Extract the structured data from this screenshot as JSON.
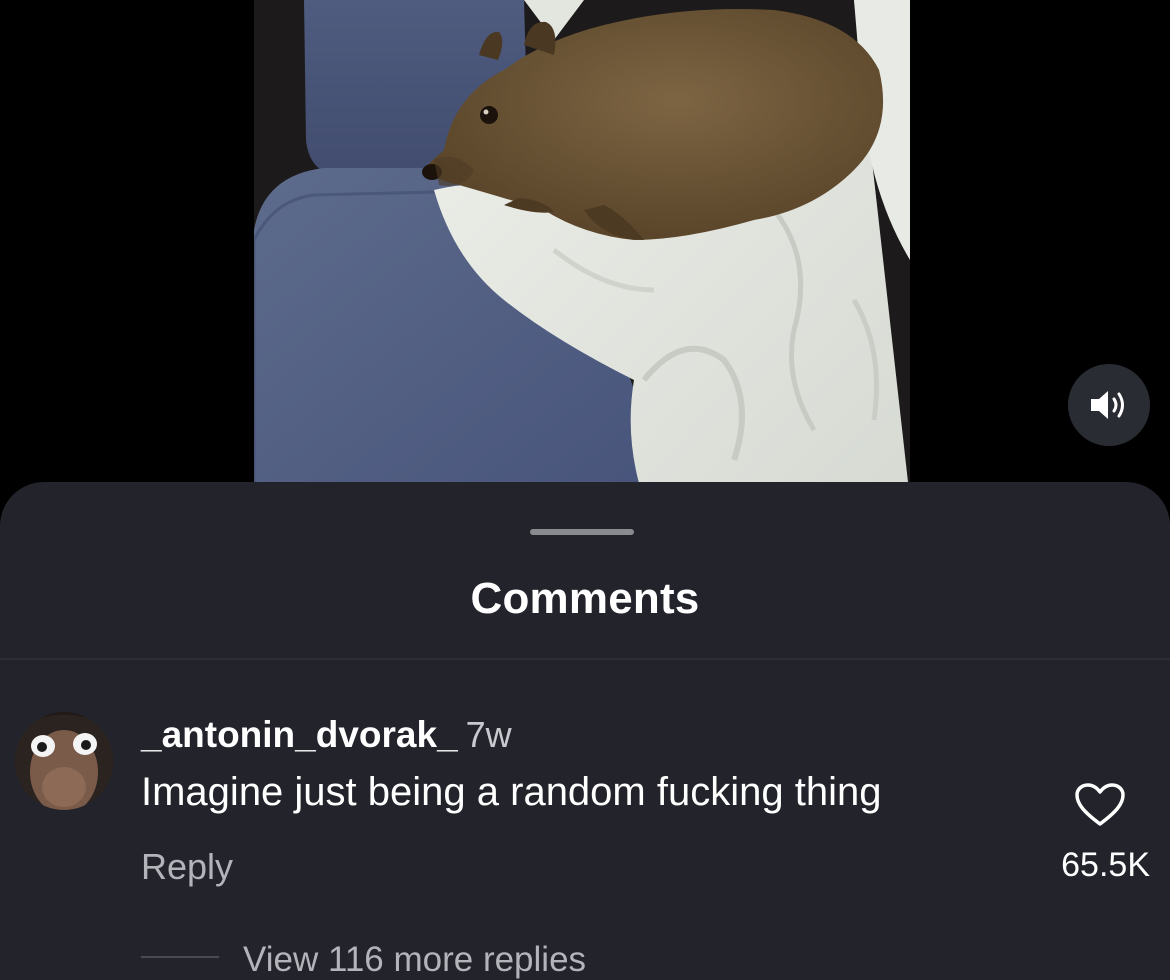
{
  "video": {
    "volume_icon": "speaker-volume-icon"
  },
  "comments_sheet": {
    "title": "Comments",
    "comments": [
      {
        "username": "_antonin_dvorak_",
        "timestamp": "7w",
        "text": "Imagine just being a random fucking thing",
        "reply_label": "Reply",
        "like_count": "65.5K",
        "like_icon": "heart-icon",
        "view_replies_label": "View 116 more replies"
      }
    ]
  },
  "colors": {
    "sheet_background": "#22232b",
    "page_background": "#000000",
    "text_primary": "#ffffff",
    "text_secondary": "#b3b4b9"
  }
}
